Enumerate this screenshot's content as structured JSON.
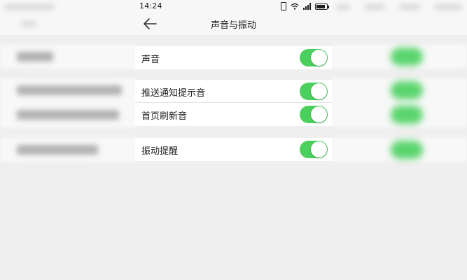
{
  "status_bar": {
    "time": "14:24",
    "icons": [
      "vibrate-icon",
      "wifi-icon",
      "signal-icon",
      "battery-icon"
    ]
  },
  "nav": {
    "back_icon": "arrow-left-icon",
    "title": "声音与振动"
  },
  "settings": {
    "group1": [
      {
        "label": "声音",
        "enabled": true
      }
    ],
    "group2": [
      {
        "label": "推送通知提示音",
        "enabled": true
      },
      {
        "label": "首页刷新音",
        "enabled": true
      }
    ],
    "group3": [
      {
        "label": "振动提醒",
        "enabled": true
      }
    ]
  },
  "colors": {
    "toggle_on": "#4bd05d",
    "background": "#efefef",
    "row_bg": "#ffffff"
  }
}
